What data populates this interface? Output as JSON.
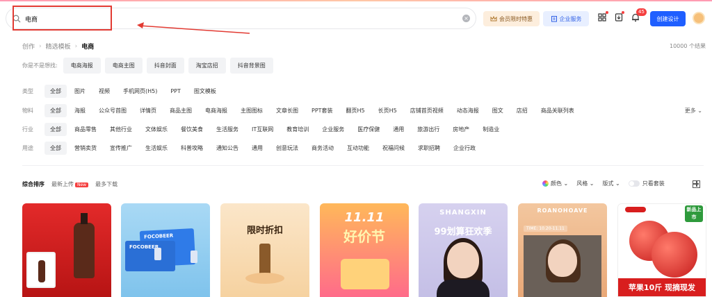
{
  "search": {
    "value": "电商"
  },
  "header": {
    "vip_label": "会员限时特惠",
    "enterprise_label": "企业服务",
    "notification_count": "45",
    "create_label": "创建设计"
  },
  "breadcrumb": {
    "items": [
      "创作",
      "精选模板",
      "电商"
    ]
  },
  "result_count": "10000 个结果",
  "guess": {
    "label": "你是不是想找:",
    "chips": [
      "电商海报",
      "电商主图",
      "抖音封面",
      "淘宝店招",
      "抖音背景图"
    ]
  },
  "filters": {
    "type": {
      "label": "类型",
      "options": [
        "全部",
        "图片",
        "视频",
        "手机网页(H5)",
        "PPT",
        "图文模板"
      ]
    },
    "material": {
      "label": "物料",
      "options": [
        "全部",
        "海报",
        "公众号首图",
        "详情页",
        "商品主图",
        "电商海报",
        "主图图标",
        "文章长图",
        "PPT套装",
        "翻页H5",
        "长页H5",
        "店铺首页视频",
        "动态海报",
        "图文",
        "店招",
        "商品关联列表"
      ]
    },
    "industry": {
      "label": "行业",
      "options": [
        "全部",
        "商品零售",
        "其他行业",
        "文体娱乐",
        "餐饮美食",
        "生活服务",
        "IT互联网",
        "教育培训",
        "企业服务",
        "医疗保健",
        "通用",
        "旅游出行",
        "房地产",
        "制造业"
      ]
    },
    "usage": {
      "label": "用途",
      "options": [
        "全部",
        "营销卖货",
        "宣传推广",
        "生活娱乐",
        "科普攻略",
        "通知公告",
        "通用",
        "创意玩法",
        "商务活动",
        "互动功能",
        "祝福问候",
        "求职招聘",
        "企业行政"
      ]
    },
    "more_label": "更多"
  },
  "sort": {
    "options": [
      "综合排序",
      "最新上传",
      "最多下载"
    ],
    "new_tag": "New"
  },
  "tools": {
    "color_label": "颜色",
    "style_label": "风格",
    "layout_label": "版式",
    "member_only_label": "只看套装"
  },
  "cards": {
    "c2_brand": "FOCOBEER",
    "c2_brand_b": "FOCOBEER",
    "c3_title": "限时折扣",
    "c4_title": "11.11",
    "c4_sub": "好价节",
    "c5_title": "SHANGXIN",
    "c5_sub": "99划算狂欢季",
    "c6_title": "ROANOHOAVE",
    "c6_date": "TIME: 10.20-11.11",
    "c7_tag": "新品上市",
    "c7_banner": "苹果10斤 现摘现发"
  },
  "colors": {
    "accent": "#1f5fff",
    "annotation": "#e23a32",
    "badge": "#f53f3f"
  }
}
